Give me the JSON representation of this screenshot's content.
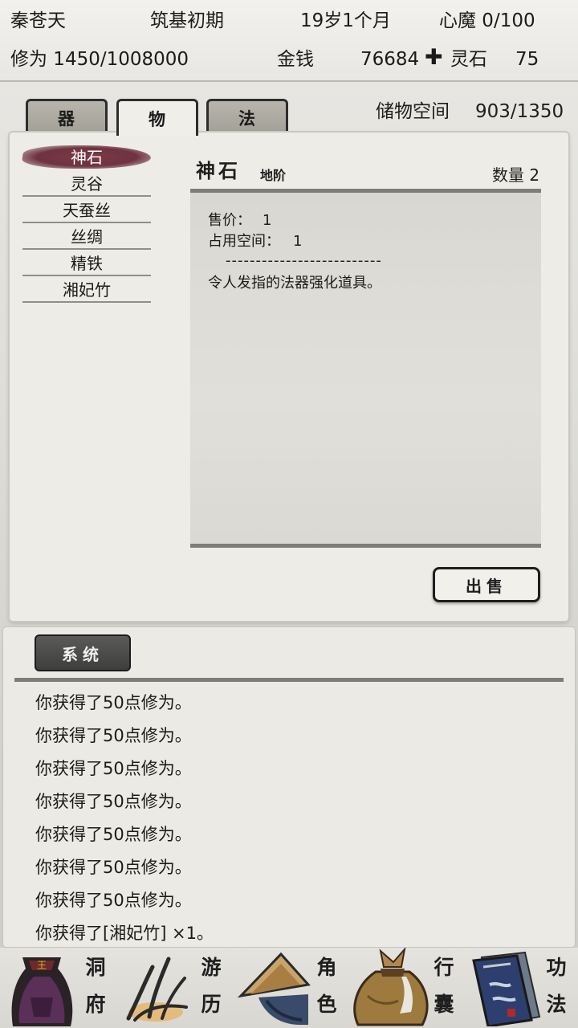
{
  "status": {
    "name": "秦苍天",
    "realm": "筑基初期",
    "age": "19岁1个月",
    "demon": "心魔 0/100",
    "cultivation": "修为 1450/1008000",
    "money_label": "金钱",
    "money_value": "76684",
    "plus": "✚",
    "spirit_stone_label": "灵石",
    "spirit_stone_value": "75"
  },
  "tabs": [
    {
      "label": "器"
    },
    {
      "label": "物"
    },
    {
      "label": "法"
    }
  ],
  "storage": {
    "label": "储物空间",
    "value": "903/1350"
  },
  "items": [
    {
      "label": "神石"
    },
    {
      "label": "灵谷"
    },
    {
      "label": "天蚕丝"
    },
    {
      "label": "丝绸"
    },
    {
      "label": "精铁"
    },
    {
      "label": "湘妃竹"
    }
  ],
  "detail": {
    "name": "神石",
    "grade": "地阶",
    "quantity": "数量 2",
    "price_label": "售价：",
    "price_value": "1",
    "space_label": "占用空间：",
    "space_value": "1",
    "separator": "--------------------------",
    "description": "令人发指的法器强化道具。",
    "sell_label": "出售"
  },
  "log": {
    "tab_label": "系统",
    "lines": [
      "你获得了50点修为。",
      "你获得了50点修为。",
      "你获得了50点修为。",
      "你获得了50点修为。",
      "你获得了50点修为。",
      "你获得了50点修为。",
      "你获得了50点修为。",
      "你获得了[湘妃竹] ×1。"
    ]
  },
  "nav": [
    {
      "top": "洞",
      "bottom": "府",
      "icon": "cave-mansion-icon"
    },
    {
      "top": "游",
      "bottom": "历",
      "icon": "travel-icon"
    },
    {
      "top": "角",
      "bottom": "色",
      "icon": "character-icon"
    },
    {
      "top": "行",
      "bottom": "囊",
      "icon": "bag-icon"
    },
    {
      "top": "功",
      "bottom": "法",
      "icon": "technique-book-icon"
    }
  ],
  "colors": {
    "selected_brush": "#6e3340",
    "panel": "#edece6",
    "system_tab": "#3e3e3d"
  }
}
